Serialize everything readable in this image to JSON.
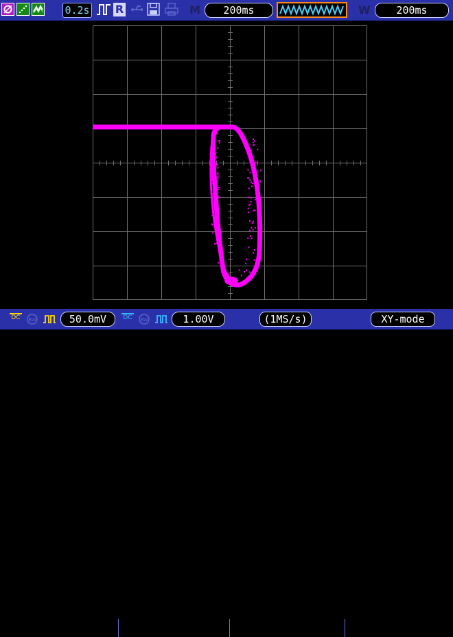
{
  "toolbar": {
    "timebase_display": "0.2s",
    "run_mode_label": "R",
    "delay_label": "M",
    "delay_value": "200ms",
    "window_label": "W",
    "window_value": "200ms",
    "icons": [
      "xy-mode-icon",
      "dot-display-icon",
      "persist-display-icon",
      "trigger-pulse-icon",
      "usb-icon",
      "save-icon",
      "print-icon",
      "zoom-waveform-icon"
    ]
  },
  "status": {
    "ch1_coupling": "DC",
    "ch1_scale": "50.0mV",
    "ch2_coupling": "DC",
    "ch2_scale": "1.00V",
    "sample_rate": "(1MS/s)",
    "mode": "XY-mode"
  },
  "colors": {
    "bar_bg": "#2a30a8",
    "trace": "#ff00ff",
    "ch1_accent": "#ffd800",
    "ch2_accent": "#3ab8ff",
    "grid": "#707070"
  }
}
